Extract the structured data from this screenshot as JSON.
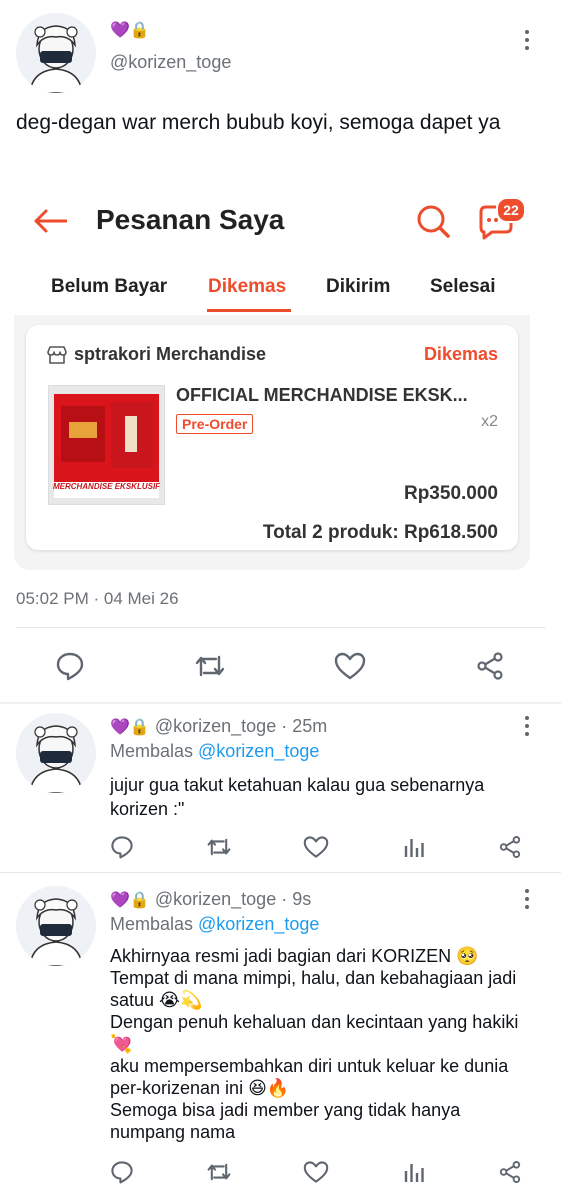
{
  "main_tweet": {
    "badges": "💜🔒",
    "handle": "@korizen_toge",
    "text": "deg-degan war merch bubub koyi, semoga dapet ya",
    "timestamp": "05:02 PM · 04 Mei 26"
  },
  "shopee": {
    "title": "Pesanan Saya",
    "chat_badge": "22",
    "tabs": [
      "Belum Bayar",
      "Dikemas",
      "Dikirim",
      "Selesai"
    ],
    "active_tab": "Dikemas",
    "shop_name": "sptrakori Merchandise",
    "status": "Dikemas",
    "product_name": "OFFICIAL MERCHANDISE EKSK...",
    "tag": "Pre-Order",
    "qty": "x2",
    "price": "Rp350.000",
    "total": "Total 2 produk: Rp618.500",
    "thumb_caption": "MERCHANDISE EKSKLUSIF"
  },
  "replies": [
    {
      "badges": "💜🔒",
      "handle": "@korizen_toge",
      "time": "· 25m",
      "replying_prefix": "Membalas ",
      "replying_to": "@korizen_toge",
      "text": "jujur gua takut ketahuan kalau gua sebenarnya korizen :\""
    },
    {
      "badges": "💜🔒",
      "handle": "@korizen_toge",
      "time": "· 9s",
      "replying_prefix": "Membalas ",
      "replying_to": "@korizen_toge",
      "lines": [
        "Akhirnyaa resmi jadi bagian dari KORIZEN 🥺",
        "Tempat di mana mimpi, halu, dan kebahagiaan jadi",
        "satuu 😭💫",
        "Dengan penuh kehaluan dan kecintaan yang hakiki",
        "💘",
        "aku mempersembahkan diri untuk keluar ke dunia",
        "per-korizenan ini 😆🔥",
        "Semoga bisa jadi member yang tidak hanya",
        "numpang nama"
      ]
    }
  ],
  "icons": [
    "reply-icon",
    "retweet-icon",
    "like-icon",
    "analytics-icon",
    "share-icon",
    "more-icon"
  ],
  "colors": {
    "accent_blue": "#1d9bf0",
    "shopee_orange": "#ee4d2d"
  }
}
